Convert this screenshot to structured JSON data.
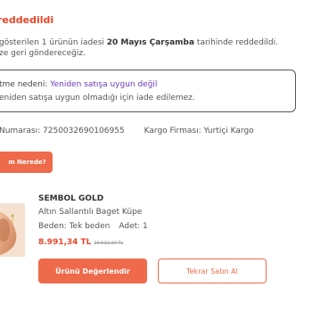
{
  "status": {
    "title": "reddedildi"
  },
  "description": {
    "part1": "gösterilen 1 ürünün iadesi ",
    "date": "20 Mayıs Çarşamba",
    "part2": " tarihinde reddedildi.",
    "line2": "ze geri göndereceğiz."
  },
  "reason": {
    "label": "tme nedeni: ",
    "value": "Yeniden satışa uygun değil",
    "detail": "eniden satışa uygun olmadığı için iade edilemez."
  },
  "shipment": {
    "number_label": "Numarası: ",
    "number": "7250032690106955",
    "carrier_label": "Kargo Firması: ",
    "carrier": "Yurtiçi Kargo"
  },
  "track_button": {
    "label": "m Nerede?"
  },
  "product": {
    "brand": "SEMBOL GOLD",
    "name": "Altın Sallantılı Baget Küpe",
    "size_label": "Beden: ",
    "size": "Tek beden",
    "qty_label": "Adet: ",
    "qty": "1",
    "price": "8.991,34 TL",
    "old_price": "10.522,10 TL",
    "image_icon": "earring-product-image"
  },
  "actions": {
    "review_label": "Ürünü Değerlendir",
    "rebuy_label": "Tekrar Satın Al"
  },
  "colors": {
    "accent": "#e8462a",
    "button": "#ef6a4a",
    "highlight": "#6c3bbf"
  }
}
